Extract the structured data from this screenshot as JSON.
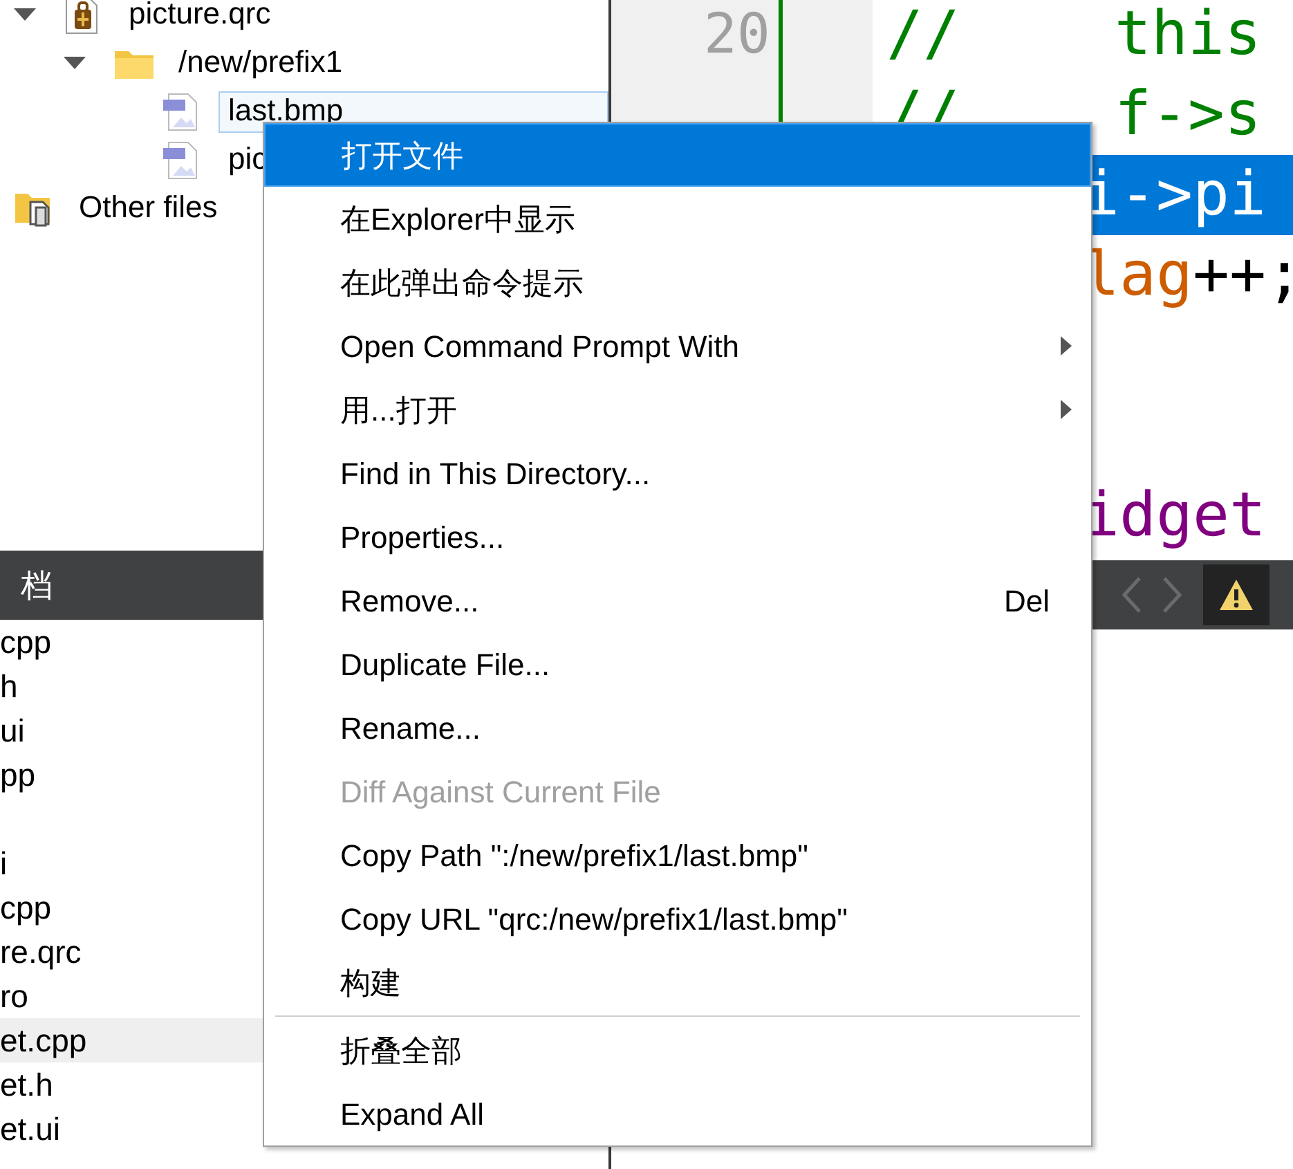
{
  "project_tree": [
    {
      "label": "picture.qrc",
      "kind": "resource",
      "expanded": true,
      "children": [
        {
          "label": "/new/prefix1",
          "kind": "folder",
          "expanded": true,
          "children": [
            {
              "label": "last.bmp",
              "kind": "image",
              "selected": true
            },
            {
              "label": "pic",
              "kind": "image",
              "selected": false
            }
          ]
        }
      ]
    },
    {
      "label": "Other files",
      "kind": "other"
    }
  ],
  "open_documents": {
    "title": "档",
    "rows": [
      {
        "text": "cpp",
        "selected": false
      },
      {
        "text": "h",
        "selected": false
      },
      {
        "text": "ui",
        "selected": false
      },
      {
        "text": "pp",
        "selected": false
      },
      {
        "selected": false
      },
      {
        "text": "i",
        "selected": false
      },
      {
        "text": "cpp",
        "selected": false
      },
      {
        "text": "re.qrc",
        "selected": false
      },
      {
        "text": "ro",
        "selected": false
      },
      {
        "text": "et.cpp",
        "selected": true
      },
      {
        "text": "et.h",
        "selected": false
      },
      {
        "text": "et.ui",
        "selected": false
      }
    ]
  },
  "editor": {
    "line_numbers": [
      "20"
    ],
    "lines": [
      {
        "marker": "//",
        "segments": [
          {
            "text": "this",
            "kind": "comment"
          }
        ],
        "selected": false
      },
      {
        "marker": "//",
        "segments": [
          {
            "text": "f->s",
            "kind": "comment"
          }
        ],
        "selected": false
      },
      {
        "segments": [
          {
            "text": "i->pi",
            "kind": "plain"
          }
        ],
        "selected": true
      },
      {
        "segments": [
          {
            "text": "lag",
            "kind": "member"
          },
          {
            "text": "++;",
            "kind": "plain"
          }
        ],
        "selected": false
      },
      {
        "selected": false
      },
      {
        "selected": false
      },
      {
        "segments": [
          {
            "text": "idget",
            "kind": "type"
          }
        ],
        "selected": false
      }
    ]
  },
  "context_menu": [
    {
      "kind": "item",
      "label": "打开文件",
      "selected": true
    },
    {
      "kind": "item",
      "label": "在Explorer中显示",
      "selected": false
    },
    {
      "kind": "item",
      "label": "在此弹出命令提示",
      "selected": false
    },
    {
      "kind": "submenu",
      "label": "Open Command Prompt With",
      "selected": false
    },
    {
      "kind": "submenu",
      "label": "用...打开",
      "selected": false
    },
    {
      "kind": "item",
      "label": "Find in This Directory...",
      "selected": false
    },
    {
      "kind": "item",
      "label": "Properties...",
      "selected": false
    },
    {
      "kind": "item",
      "label": "Remove...",
      "shortcut": "Del",
      "selected": false
    },
    {
      "kind": "item",
      "label": "Duplicate File...",
      "selected": false
    },
    {
      "kind": "item",
      "label": "Rename...",
      "selected": false
    },
    {
      "kind": "disabled",
      "label": "Diff Against Current File",
      "selected": false
    },
    {
      "kind": "item",
      "label": "Copy Path \":/new/prefix1/last.bmp\"",
      "selected": false
    },
    {
      "kind": "item",
      "label": "Copy URL \"qrc:/new/prefix1/last.bmp\"",
      "selected": false
    },
    {
      "kind": "item",
      "label": "构建",
      "selected": false
    },
    {
      "kind": "separator"
    },
    {
      "kind": "item",
      "label": "折叠全部",
      "selected": false
    },
    {
      "kind": "item",
      "label": "Expand All",
      "selected": false
    }
  ]
}
